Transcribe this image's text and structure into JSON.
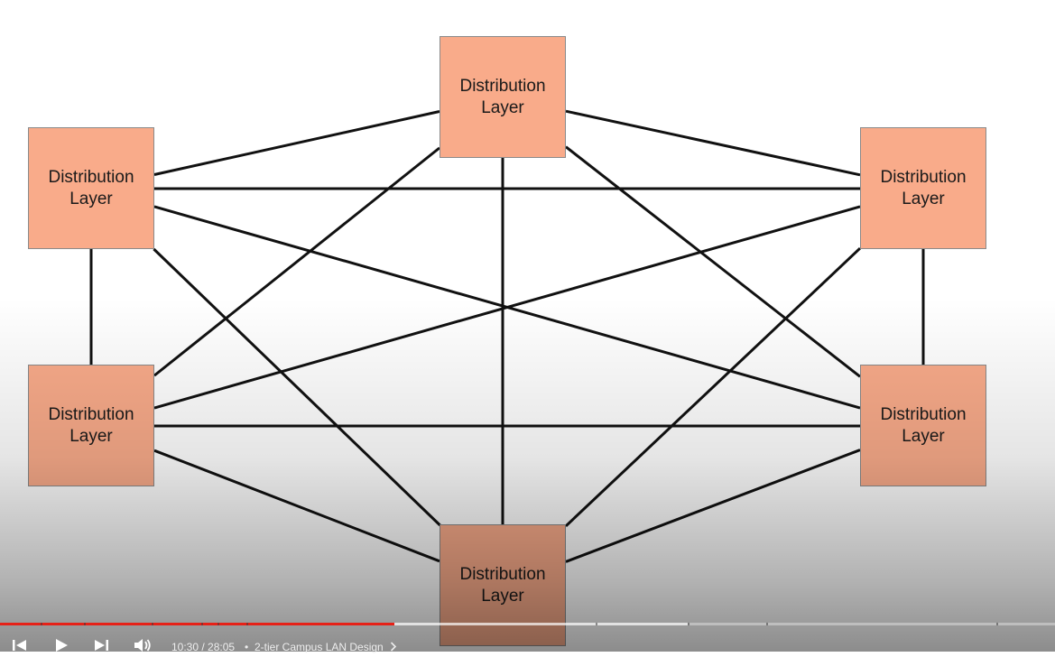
{
  "diagram": {
    "nodes": [
      {
        "id": "top",
        "line1": "Distribution",
        "line2": "Layer"
      },
      {
        "id": "upper-left",
        "line1": "Distribution",
        "line2": "Layer"
      },
      {
        "id": "upper-right",
        "line1": "Distribution",
        "line2": "Layer"
      },
      {
        "id": "lower-left",
        "line1": "Distribution",
        "line2": "Layer"
      },
      {
        "id": "lower-right",
        "line1": "Distribution",
        "line2": "Layer"
      },
      {
        "id": "bottom",
        "line1": "Distribution",
        "line2": "Layer"
      }
    ],
    "links": [
      [
        "top",
        "upper-left"
      ],
      [
        "top",
        "upper-right"
      ],
      [
        "top",
        "lower-left"
      ],
      [
        "top",
        "lower-right"
      ],
      [
        "top",
        "bottom"
      ],
      [
        "upper-left",
        "upper-right"
      ],
      [
        "upper-left",
        "lower-left"
      ],
      [
        "upper-left",
        "lower-right"
      ],
      [
        "upper-left",
        "bottom"
      ],
      [
        "upper-right",
        "lower-left"
      ],
      [
        "upper-right",
        "lower-right"
      ],
      [
        "upper-right",
        "bottom"
      ],
      [
        "lower-left",
        "lower-right"
      ],
      [
        "lower-left",
        "bottom"
      ],
      [
        "lower-right",
        "bottom"
      ]
    ],
    "node_color": "#f9ab8a",
    "line_color": "#111111"
  },
  "player": {
    "current_time": "10:30",
    "duration": "28:05",
    "time_display": "10:30 / 28:05",
    "separator": "•",
    "chapter_title": "2-tier Campus LAN Design",
    "played_fraction": 0.374,
    "buffered_fraction": 0.652,
    "accent_color": "#e62117",
    "icons": [
      "previous-icon",
      "play-icon",
      "next-icon",
      "volume-icon",
      "chevron-right-icon"
    ]
  }
}
